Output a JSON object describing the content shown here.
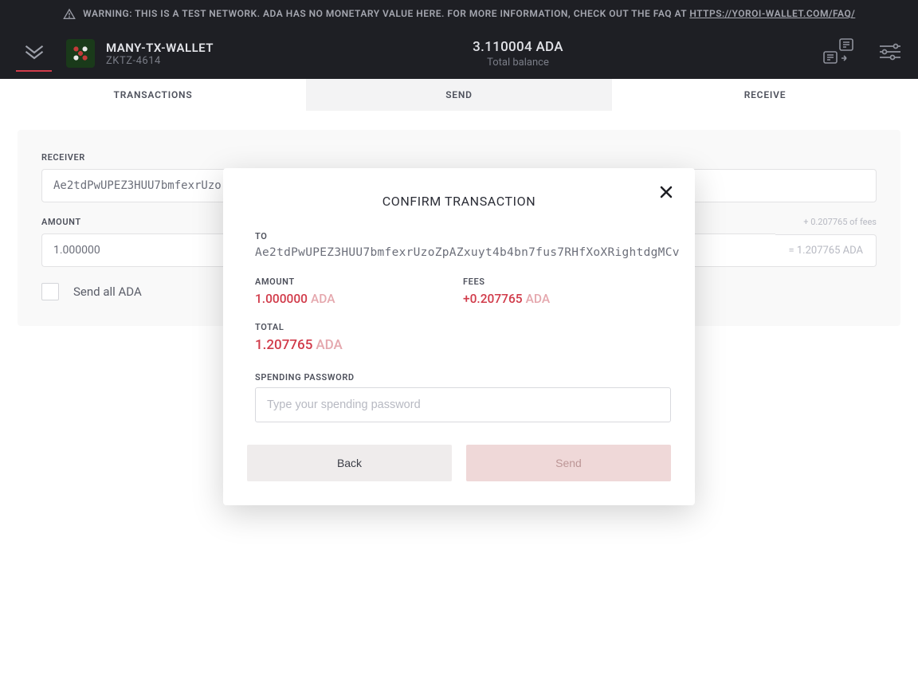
{
  "warning": {
    "text": "WARNING: THIS IS A TEST NETWORK. ADA HAS NO MONETARY VALUE HERE. FOR MORE INFORMATION, CHECK OUT THE FAQ AT ",
    "link_text": "HTTPS://YOROI-WALLET.COM/FAQ/"
  },
  "header": {
    "wallet_name": "MANY-TX-WALLET",
    "wallet_plate": "ZKTZ-4614",
    "balance_value": "3.110004 ADA",
    "balance_label": "Total balance"
  },
  "tabs": {
    "transactions": "TRANSACTIONS",
    "send": "SEND",
    "receive": "RECEIVE"
  },
  "form": {
    "receiver_label": "RECEIVER",
    "receiver_value": "Ae2tdPwUPEZ3HUU7bmfexrUzo.",
    "amount_label": "AMOUNT",
    "amount_value": "1.000000",
    "fee_hint": "+ 0.207765 of fees",
    "total_hint": "= 1.207765 ADA",
    "send_all_label": "Send all ADA"
  },
  "modal": {
    "title": "CONFIRM TRANSACTION",
    "to_label": "TO",
    "to_address": "Ae2tdPwUPEZ3HUU7bmfexrUzoZpAZxuyt4b4bn7fus7RHfXoXRightdgMCv",
    "amount_label": "AMOUNT",
    "amount_value": "1.000000",
    "amount_unit": "ADA",
    "fees_label": "FEES",
    "fees_value": "+0.207765",
    "fees_unit": "ADA",
    "total_label": "TOTAL",
    "total_value": "1.207765",
    "total_unit": "ADA",
    "password_label": "SPENDING PASSWORD",
    "password_placeholder": "Type your spending password",
    "back_label": "Back",
    "send_label": "Send"
  },
  "colors": {
    "accent": "#d13b4a",
    "dark": "#1e1f24"
  }
}
